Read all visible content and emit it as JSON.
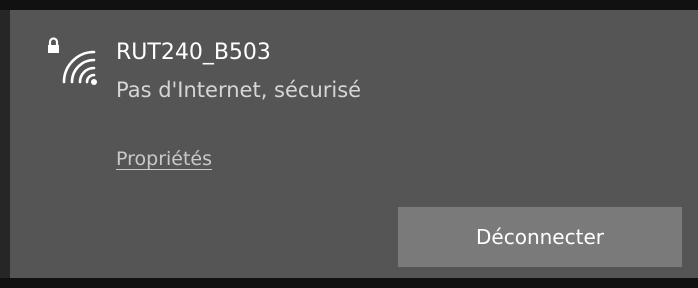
{
  "network": {
    "ssid": "RUT240_B503",
    "status": "Pas d'Internet, sécurisé",
    "properties_link": "Propriétés",
    "disconnect_label": "Déconnecter",
    "icon": "wifi-secured-icon"
  },
  "colors": {
    "panel_bg": "#555555",
    "button_bg": "#7a7a7a",
    "text_primary": "#ffffff",
    "text_secondary": "#d6d6d6"
  }
}
